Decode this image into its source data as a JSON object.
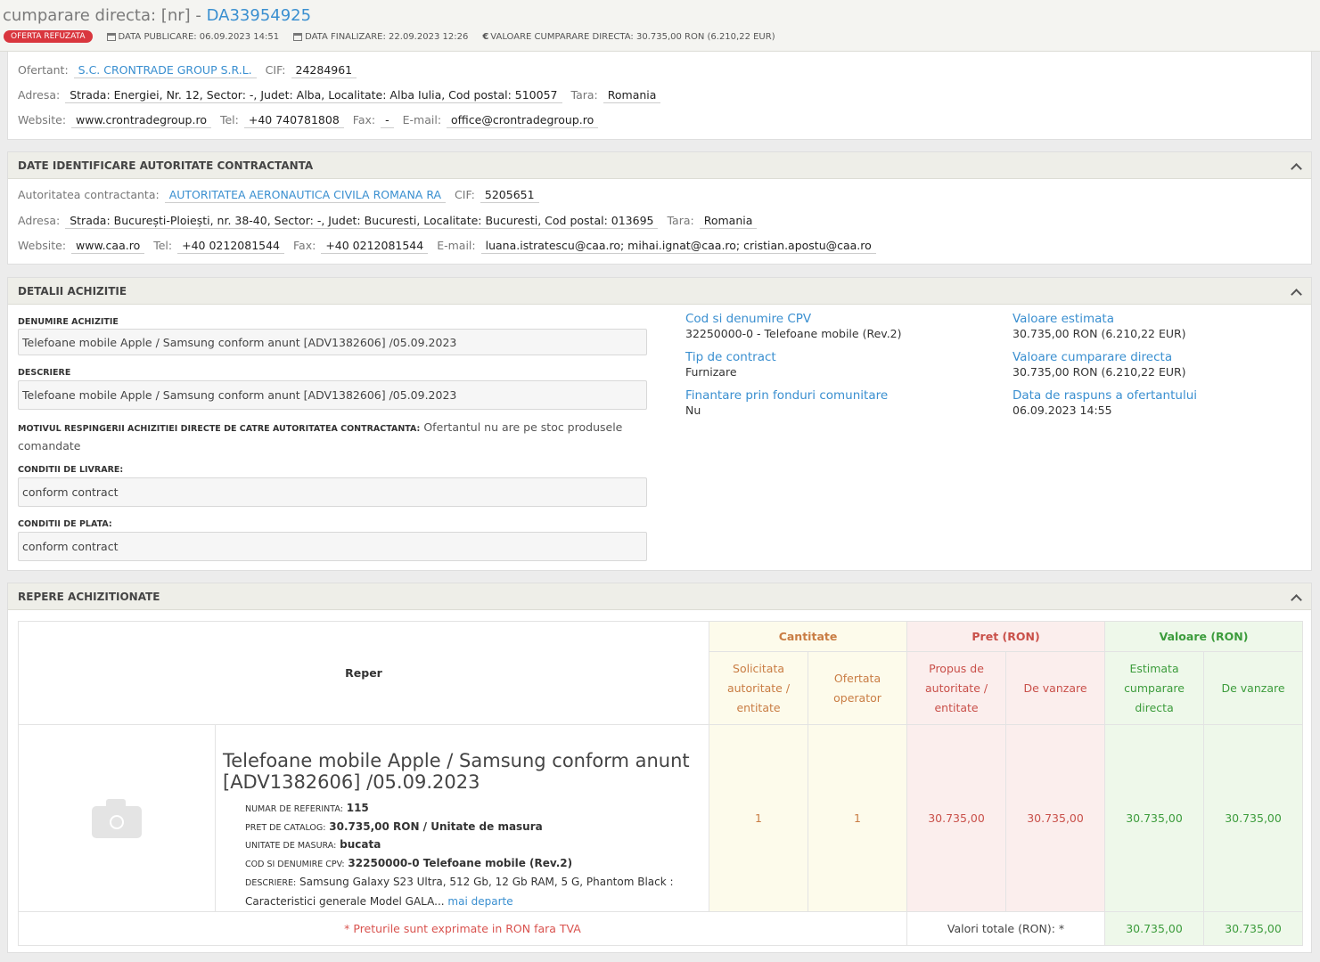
{
  "header": {
    "title_prefix": "cumparare directa: [nr] - ",
    "code": "DA33954925",
    "status_badge": "OFERTA REFUZATA",
    "data_publicare": "DATA PUBLICARE: 06.09.2023 14:51",
    "data_finalizare": "DATA FINALIZARE: 22.09.2023 12:26",
    "valoare": "VALOARE CUMPARARE DIRECTA: 30.735,00  RON (6.210,22  EUR)"
  },
  "ofertant": {
    "ofertant_label": "Ofertant:",
    "ofertant_value": "S.C. CRONTRADE GROUP S.R.L.",
    "cif_label": "CIF:",
    "cif_value": "24284961",
    "adresa_label": "Adresa:",
    "adresa_value": "Strada: Energiei, Nr. 12, Sector: -, Judet: Alba, Localitate: Alba Iulia, Cod postal: 510057",
    "tara_label": "Tara:",
    "tara_value": "Romania",
    "website_label": "Website:",
    "website_value": "www.crontradegroup.ro",
    "tel_label": "Tel:",
    "tel_value": "+40 740781808",
    "fax_label": "Fax:",
    "fax_value": "-",
    "email_label": "E-mail:",
    "email_value": "office@crontradegroup.ro"
  },
  "autoritate": {
    "section_title": "DATE IDENTIFICARE AUTORITATE CONTRACTANTA",
    "autoritate_label": "Autoritatea contractanta:",
    "autoritate_value": "AUTORITATEA AERONAUTICA CIVILA ROMANA RA",
    "cif_label": "CIF:",
    "cif_value": "5205651",
    "adresa_label": "Adresa:",
    "adresa_value": "Strada: București-Ploiești, nr. 38-40, Sector: -, Judet: Bucuresti, Localitate: Bucuresti, Cod postal: 013695",
    "tara_label": "Tara:",
    "tara_value": "Romania",
    "website_label": "Website:",
    "website_value": "www.caa.ro",
    "tel_label": "Tel:",
    "tel_value": "+40 0212081544",
    "fax_label": "Fax:",
    "fax_value": "+40 0212081544",
    "email_label": "E-mail:",
    "email_value": "luana.istratescu@caa.ro; mihai.ignat@caa.ro; cristian.apostu@caa.ro"
  },
  "detalii": {
    "section_title": "DETALII ACHIZITIE",
    "denumire_label": "DENUMIRE ACHIZITIE",
    "denumire_value": "Telefoane mobile Apple / Samsung conform anunt [ADV1382606] /05.09.2023",
    "descriere_label": "DESCRIERE",
    "descriere_value": "Telefoane mobile Apple / Samsung conform anunt [ADV1382606] /05.09.2023",
    "motiv_label": "MOTIVUL RESPINGERII ACHIZITIEI DIRECTE DE CATRE AUTORITATEA CONTRACTANTA:",
    "motiv_value": " Ofertantul nu are pe stoc produsele comandate",
    "livrare_label": "CONDITII DE LIVRARE:",
    "livrare_value": "conform contract",
    "plata_label": "CONDITII DE PLATA:",
    "plata_value": "conform contract",
    "cpv_label": "Cod si denumire CPV",
    "cpv_value": "32250000-0 - Telefoane mobile (Rev.2)",
    "tip_label": "Tip de contract",
    "tip_value": "Furnizare",
    "finantare_label": "Finantare prin fonduri comunitare",
    "finantare_value": "Nu",
    "val_estimata_label": "Valoare estimata",
    "val_estimata_value": "30.735,00  RON (6.210,22  EUR)",
    "val_cumparare_label": "Valoare cumparare directa",
    "val_cumparare_value": "30.735,00  RON (6.210,22  EUR)",
    "data_raspuns_label": "Data de raspuns a ofertantului",
    "data_raspuns_value": "06.09.2023 14:55"
  },
  "repere": {
    "section_title": "REPERE ACHIZITIONATE",
    "col_reper": "Reper",
    "col_cantitate": "Cantitate",
    "col_pret": "Pret (RON)",
    "col_valoare": "Valoare (RON)",
    "sub_solicitata": "Solicitata autoritate / entitate",
    "sub_ofertata": "Ofertata operator",
    "sub_propus": "Propus de autoritate / entitate",
    "sub_vanzare_pret": "De vanzare",
    "sub_estimata": "Estimata cumparare directa",
    "sub_vanzare_val": "De vanzare",
    "item": {
      "title": "Telefoane mobile Apple / Samsung conform anunt [ADV1382606] /05.09.2023",
      "ref_label": "NUMAR DE REFERINTA:",
      "ref_value": "115",
      "catalog_label": "PRET DE CATALOG:",
      "catalog_value": "30.735,00  RON / Unitate de masura",
      "um_label": "UNITATE DE MASURA:",
      "um_value": "bucata",
      "cpv_label": "COD SI DENUMIRE CPV:",
      "cpv_value": "32250000-0 Telefoane mobile (Rev.2)",
      "desc_label": "DESCRIERE:",
      "desc_value": "Samsung Galaxy S23 Ultra, 512 Gb, 12 Gb RAM, 5 G, Phantom Black : Caracteristici generale Model GALA...",
      "more_link": "mai departe",
      "solicitata": "1",
      "ofertata": "1",
      "propus": "30.735,00",
      "vanzare_pret": "30.735,00",
      "estimata": "30.735,00",
      "vanzare_val": "30.735,00"
    },
    "note": "* Preturile sunt exprimate in RON fara TVA",
    "totals_label": "Valori totale (RON): *",
    "total_estimata": "30.735,00",
    "total_vanzare": "30.735,00"
  }
}
